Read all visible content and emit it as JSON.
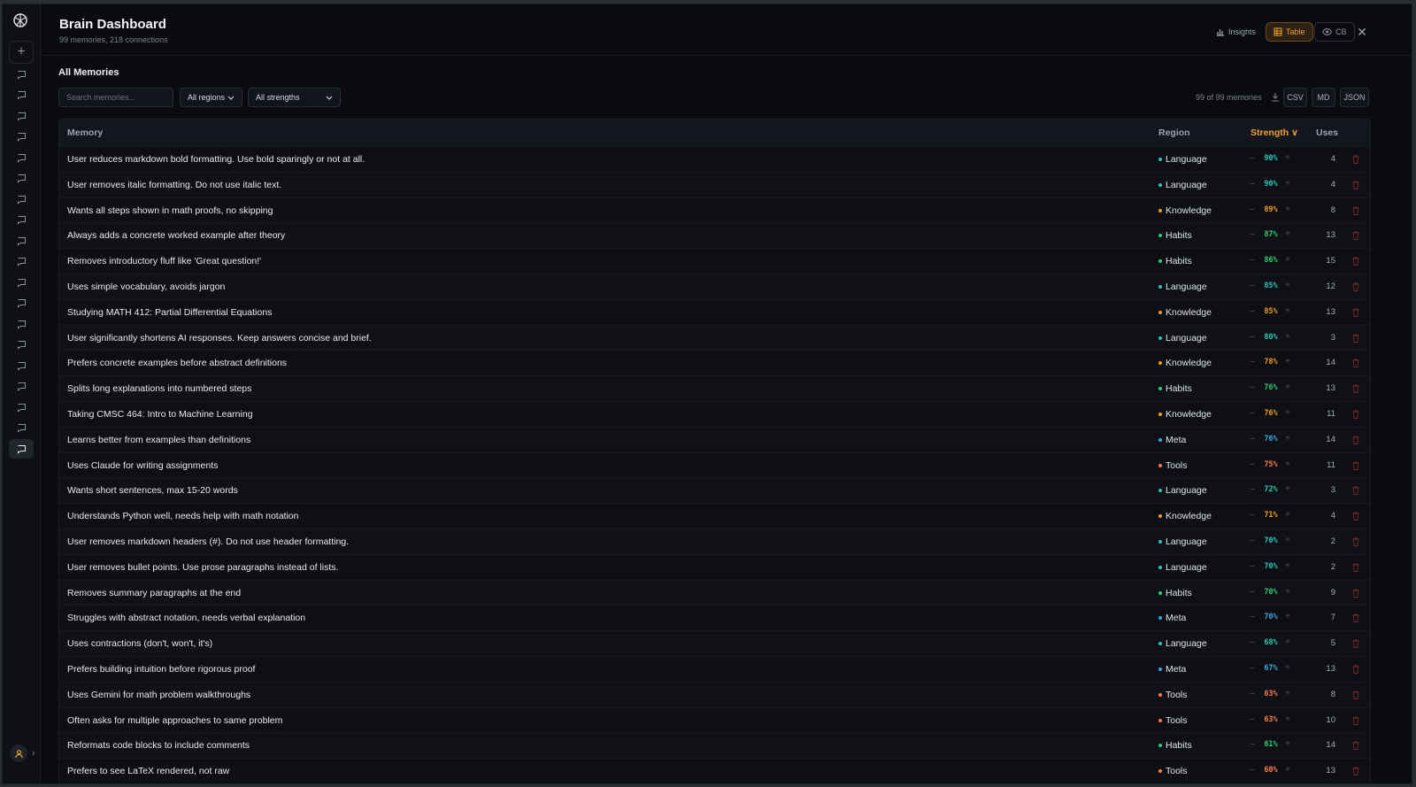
{
  "colors": {
    "accent": "#f0a13a",
    "language": "#2ec4b6",
    "knowledge": "#f39c12",
    "habits": "#2ecc71",
    "meta": "#3aa8e0",
    "tools": "#ff7a45",
    "delete": "#7a2a2a"
  },
  "sidebar": {
    "icons": [
      "logo-icon",
      "plus-icon",
      "chat-icon",
      "user-icon",
      "chevron-right-icon"
    ],
    "chat_count": 19,
    "active_index": 18
  },
  "header": {
    "title": "Brain Dashboard",
    "subtitle": "99 memories, 218 connections",
    "insights_label": "Insights",
    "table_label": "Table",
    "cb_label": "CB"
  },
  "section": {
    "title": "All Memories"
  },
  "toolbar": {
    "search_placeholder": "Search memories...",
    "region_filter": "All regions",
    "strength_filter": "All strengths",
    "count_text": "99 of 99 memories",
    "csv": "CSV",
    "md": "MD",
    "json": "JSON"
  },
  "table": {
    "headers": {
      "memory": "Memory",
      "region": "Region",
      "strength": "Strength ∨",
      "uses": "Uses"
    },
    "rows": [
      {
        "memory": "User reduces markdown bold formatting. Use bold sparingly or not at all.",
        "region": "Language",
        "strength": "90%",
        "uses": "4"
      },
      {
        "memory": "User removes italic formatting. Do not use italic text.",
        "region": "Language",
        "strength": "90%",
        "uses": "4"
      },
      {
        "memory": "Wants all steps shown in math proofs, no skipping",
        "region": "Knowledge",
        "strength": "89%",
        "uses": "8"
      },
      {
        "memory": "Always adds a concrete worked example after theory",
        "region": "Habits",
        "strength": "87%",
        "uses": "13"
      },
      {
        "memory": "Removes introductory fluff like 'Great question!'",
        "region": "Habits",
        "strength": "86%",
        "uses": "15"
      },
      {
        "memory": "Uses simple vocabulary, avoids jargon",
        "region": "Language",
        "strength": "85%",
        "uses": "12"
      },
      {
        "memory": "Studying MATH 412: Partial Differential Equations",
        "region": "Knowledge",
        "strength": "85%",
        "uses": "13"
      },
      {
        "memory": "User significantly shortens AI responses. Keep answers concise and brief.",
        "region": "Language",
        "strength": "80%",
        "uses": "3"
      },
      {
        "memory": "Prefers concrete examples before abstract definitions",
        "region": "Knowledge",
        "strength": "78%",
        "uses": "14"
      },
      {
        "memory": "Splits long explanations into numbered steps",
        "region": "Habits",
        "strength": "76%",
        "uses": "13"
      },
      {
        "memory": "Taking CMSC 464: Intro to Machine Learning",
        "region": "Knowledge",
        "strength": "76%",
        "uses": "11"
      },
      {
        "memory": "Learns better from examples than definitions",
        "region": "Meta",
        "strength": "76%",
        "uses": "14"
      },
      {
        "memory": "Uses Claude for writing assignments",
        "region": "Tools",
        "strength": "75%",
        "uses": "11"
      },
      {
        "memory": "Wants short sentences, max 15-20 words",
        "region": "Language",
        "strength": "72%",
        "uses": "3"
      },
      {
        "memory": "Understands Python well, needs help with math notation",
        "region": "Knowledge",
        "strength": "71%",
        "uses": "4"
      },
      {
        "memory": "User removes markdown headers (#). Do not use header formatting.",
        "region": "Language",
        "strength": "70%",
        "uses": "2"
      },
      {
        "memory": "User removes bullet points. Use prose paragraphs instead of lists.",
        "region": "Language",
        "strength": "70%",
        "uses": "2"
      },
      {
        "memory": "Removes summary paragraphs at the end",
        "region": "Habits",
        "strength": "70%",
        "uses": "9"
      },
      {
        "memory": "Struggles with abstract notation, needs verbal explanation",
        "region": "Meta",
        "strength": "70%",
        "uses": "7"
      },
      {
        "memory": "Uses contractions (don't, won't, it's)",
        "region": "Language",
        "strength": "68%",
        "uses": "5"
      },
      {
        "memory": "Prefers building intuition before rigorous proof",
        "region": "Meta",
        "strength": "67%",
        "uses": "13"
      },
      {
        "memory": "Uses Gemini for math problem walkthroughs",
        "region": "Tools",
        "strength": "63%",
        "uses": "8"
      },
      {
        "memory": "Often asks for multiple approaches to same problem",
        "region": "Tools",
        "strength": "63%",
        "uses": "10"
      },
      {
        "memory": "Reformats code blocks to include comments",
        "region": "Habits",
        "strength": "61%",
        "uses": "14"
      },
      {
        "memory": "Prefers to see LaTeX rendered, not raw",
        "region": "Tools",
        "strength": "60%",
        "uses": "13"
      }
    ]
  }
}
